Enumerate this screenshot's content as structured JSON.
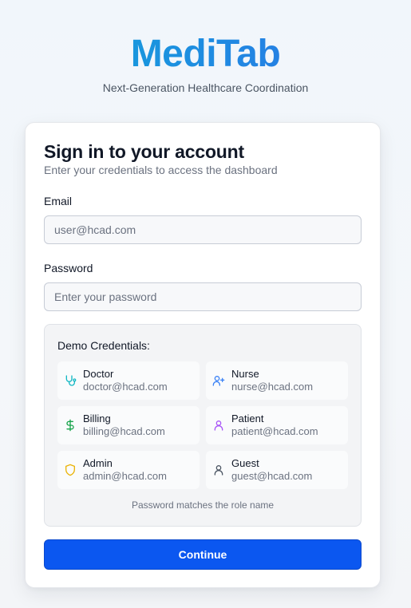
{
  "brand": {
    "name": "MediTab",
    "tagline": "Next-Generation Healthcare Coordination"
  },
  "signin": {
    "title": "Sign in to your account",
    "subtitle": "Enter your credentials to access the dashboard",
    "email_label": "Email",
    "email_placeholder": "user@hcad.com",
    "password_label": "Password",
    "password_placeholder": "Enter your password",
    "continue_label": "Continue"
  },
  "demo": {
    "title": "Demo Credentials:",
    "note": "Password matches the role name",
    "credentials": [
      {
        "role": "Doctor",
        "email": "doctor@hcad.com",
        "icon": "stethoscope-icon",
        "color": "#14b8c4"
      },
      {
        "role": "Nurse",
        "email": "nurse@hcad.com",
        "icon": "user-plus-icon",
        "color": "#3b82f6"
      },
      {
        "role": "Billing",
        "email": "billing@hcad.com",
        "icon": "dollar-icon",
        "color": "#16a34a"
      },
      {
        "role": "Patient",
        "email": "patient@hcad.com",
        "icon": "user-icon",
        "color": "#a855f7"
      },
      {
        "role": "Admin",
        "email": "admin@hcad.com",
        "icon": "shield-icon",
        "color": "#eab308"
      },
      {
        "role": "Guest",
        "email": "guest@hcad.com",
        "icon": "user-icon",
        "color": "#4b5563"
      }
    ]
  },
  "colors": {
    "brand_gradient_start": "#10a8d8",
    "brand_gradient_end": "#2f6ee8",
    "primary_button": "#0b57f0"
  }
}
